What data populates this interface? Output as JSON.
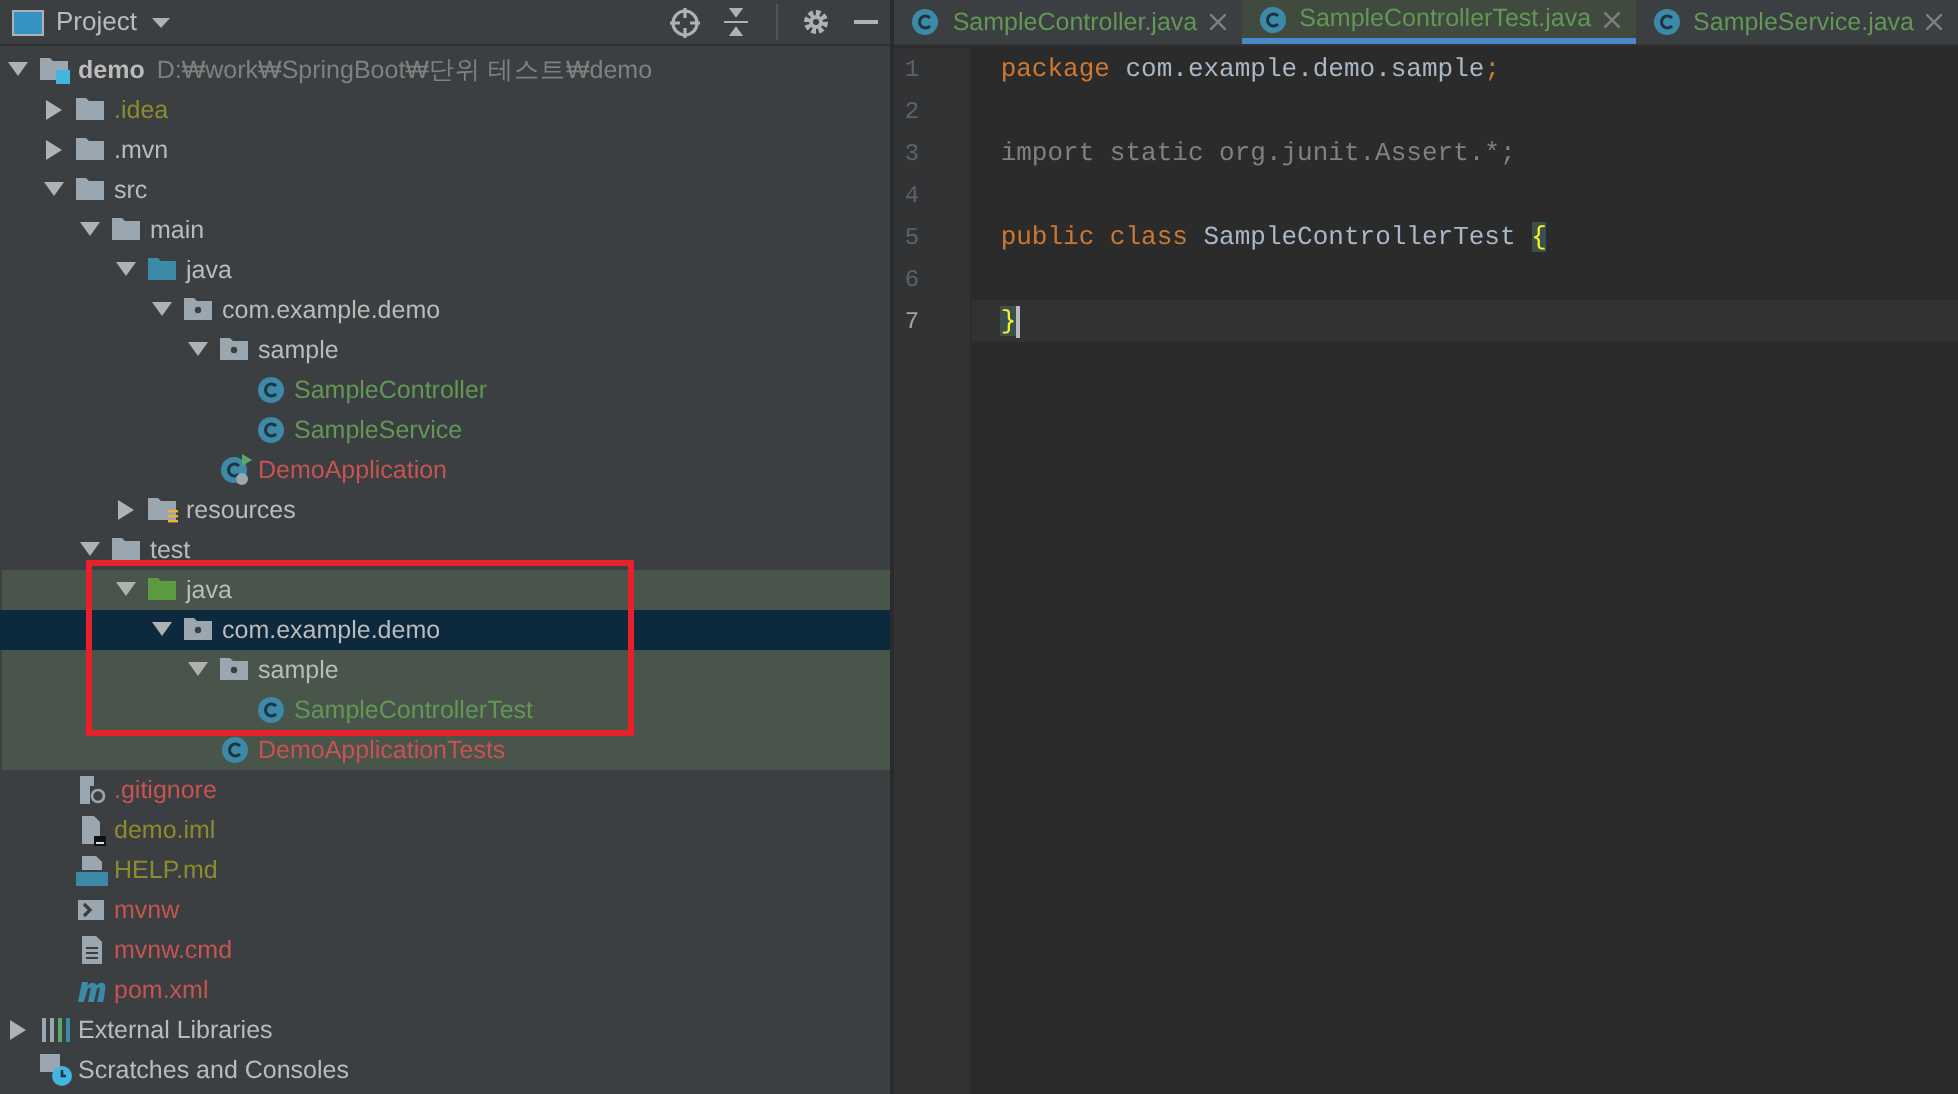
{
  "project_panel": {
    "title": "Project"
  },
  "annotation": {
    "kind": "rectangle"
  },
  "tree": [
    {
      "label": "demo",
      "path": "D:₩work₩SpringBoot₩단위 테스트₩demo",
      "kind": "module",
      "expanded": true,
      "selected": false,
      "children": [
        {
          "label": ".idea",
          "kind": "folder",
          "color": "#8c8c2c",
          "expanded": false,
          "selected": false
        },
        {
          "label": ".mvn",
          "kind": "folder",
          "expanded": false,
          "selected": false
        },
        {
          "label": "src",
          "kind": "folder",
          "expanded": true,
          "selected": false,
          "children": [
            {
              "label": "main",
              "kind": "folder",
              "expanded": true,
              "selected": false,
              "children": [
                {
                  "label": "java",
                  "kind": "source-folder",
                  "expanded": true,
                  "selected": false,
                  "children": [
                    {
                      "label": "com.example.demo",
                      "kind": "package",
                      "expanded": true,
                      "selected": false,
                      "children": [
                        {
                          "label": "sample",
                          "kind": "package",
                          "expanded": true,
                          "selected": false,
                          "children": [
                            {
                              "label": "SampleController",
                              "kind": "class",
                              "color": "#629755",
                              "selected": false
                            },
                            {
                              "label": "SampleService",
                              "kind": "class",
                              "color": "#629755",
                              "selected": false
                            }
                          ]
                        },
                        {
                          "label": "DemoApplication",
                          "kind": "app-class",
                          "color": "#c75450",
                          "selected": false
                        }
                      ]
                    }
                  ]
                },
                {
                  "label": "resources",
                  "kind": "resources-folder",
                  "expanded": false,
                  "selected": false
                }
              ]
            },
            {
              "label": "test",
              "kind": "folder",
              "expanded": true,
              "selected": false,
              "children": [
                {
                  "label": "java",
                  "kind": "test-folder",
                  "expanded": true,
                  "selected": false,
                  "highlighted": true,
                  "children": [
                    {
                      "label": "com.example.demo",
                      "kind": "package",
                      "expanded": true,
                      "selected": true,
                      "children": [
                        {
                          "label": "sample",
                          "kind": "package",
                          "expanded": true,
                          "selected": false,
                          "children": [
                            {
                              "label": "SampleControllerTest",
                              "kind": "class",
                              "color": "#629755",
                              "selected": false
                            }
                          ]
                        },
                        {
                          "label": "DemoApplicationTests",
                          "kind": "class",
                          "color": "#c75450",
                          "selected": false
                        }
                      ]
                    }
                  ]
                }
              ]
            }
          ]
        },
        {
          "label": ".gitignore",
          "kind": "ignore-file",
          "color": "#c75450",
          "selected": false
        },
        {
          "label": "demo.iml",
          "kind": "module-file",
          "color": "#8c8c2c",
          "selected": false
        },
        {
          "label": "HELP.md",
          "kind": "markdown-file",
          "color": "#8c8c2c",
          "selected": false
        },
        {
          "label": "mvnw",
          "kind": "shell-file",
          "color": "#c75450",
          "selected": false
        },
        {
          "label": "mvnw.cmd",
          "kind": "text-file",
          "color": "#c75450",
          "selected": false
        },
        {
          "label": "pom.xml",
          "kind": "maven-file",
          "color": "#c75450",
          "selected": false
        }
      ]
    },
    {
      "label": "External Libraries",
      "kind": "libraries",
      "expanded": false,
      "selected": false
    },
    {
      "label": "Scratches and Consoles",
      "kind": "scratches",
      "selected": false
    }
  ],
  "editor_tabs": [
    {
      "label": "SampleController.java",
      "selected": false
    },
    {
      "label": "SampleControllerTest.java",
      "selected": true
    },
    {
      "label": "SampleService.java",
      "selected": false
    }
  ],
  "code_lines": [
    {
      "number": "1",
      "tokens": [
        {
          "kind": "keyword",
          "text": "package "
        },
        {
          "kind": "plain",
          "text": "com.example.demo.sample"
        },
        {
          "kind": "keyword",
          "text": ";"
        }
      ]
    },
    {
      "number": "2"
    },
    {
      "number": "3",
      "tokens": [
        {
          "kind": "unused",
          "text": "import static org.junit.Assert.*;"
        }
      ]
    },
    {
      "number": "4"
    },
    {
      "number": "5",
      "tokens": [
        {
          "kind": "keyword",
          "text": "public class "
        },
        {
          "kind": "plain",
          "text": "SampleControllerTest "
        },
        {
          "kind": "brace_match",
          "text": "{"
        }
      ]
    },
    {
      "number": "6"
    },
    {
      "number": "7",
      "current": true,
      "tokens": [
        {
          "kind": "brace_match",
          "text": "}"
        }
      ]
    }
  ]
}
